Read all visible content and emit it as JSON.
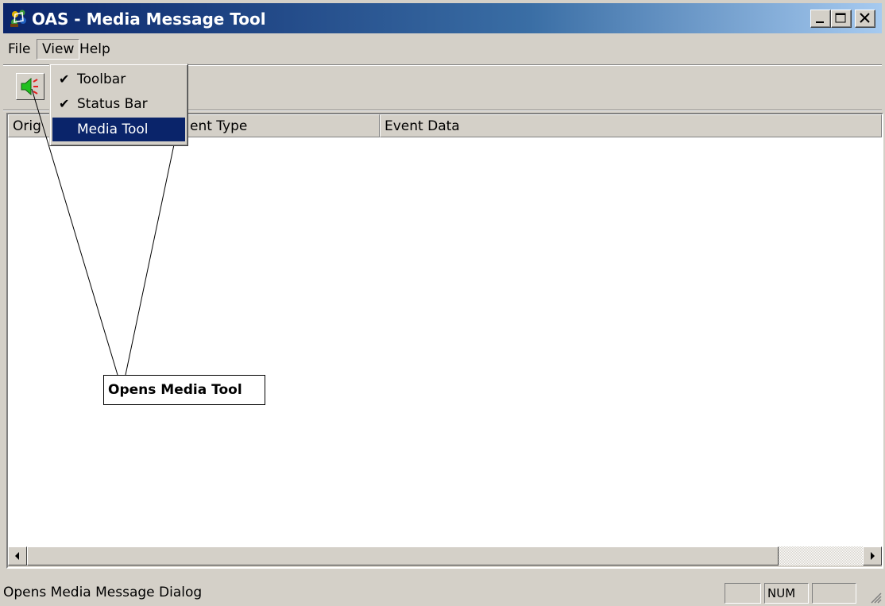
{
  "window": {
    "title": "OAS - Media Message Tool",
    "icon": "oas-app-icon",
    "controls": [
      "minimize-icon",
      "maximize-icon",
      "close-icon"
    ]
  },
  "menubar": {
    "items": [
      {
        "label": "File"
      },
      {
        "label": "View"
      },
      {
        "label": "Help"
      }
    ]
  },
  "view_menu": {
    "items": [
      {
        "label": "Toolbar",
        "checked": true
      },
      {
        "label": "Status Bar",
        "checked": true
      },
      {
        "label": "Media Tool",
        "checked": false,
        "highlighted": true
      }
    ],
    "check_glyph": "✔"
  },
  "toolbar": {
    "buttons": [
      {
        "icon": "speaker-icon"
      }
    ]
  },
  "list": {
    "columns": [
      {
        "label": "Orig"
      },
      {
        "label": "ent Type"
      },
      {
        "label": "Event Data"
      }
    ],
    "rows": []
  },
  "callout": {
    "text": "Opens Media Tool"
  },
  "statusbar": {
    "text": "Opens Media Message Dialog",
    "panels": [
      "",
      "NUM",
      ""
    ]
  },
  "colors": {
    "face": "#d4d0c8",
    "title_start": "#0a246a",
    "title_end": "#a6caf0",
    "highlight": "#0a246a"
  }
}
